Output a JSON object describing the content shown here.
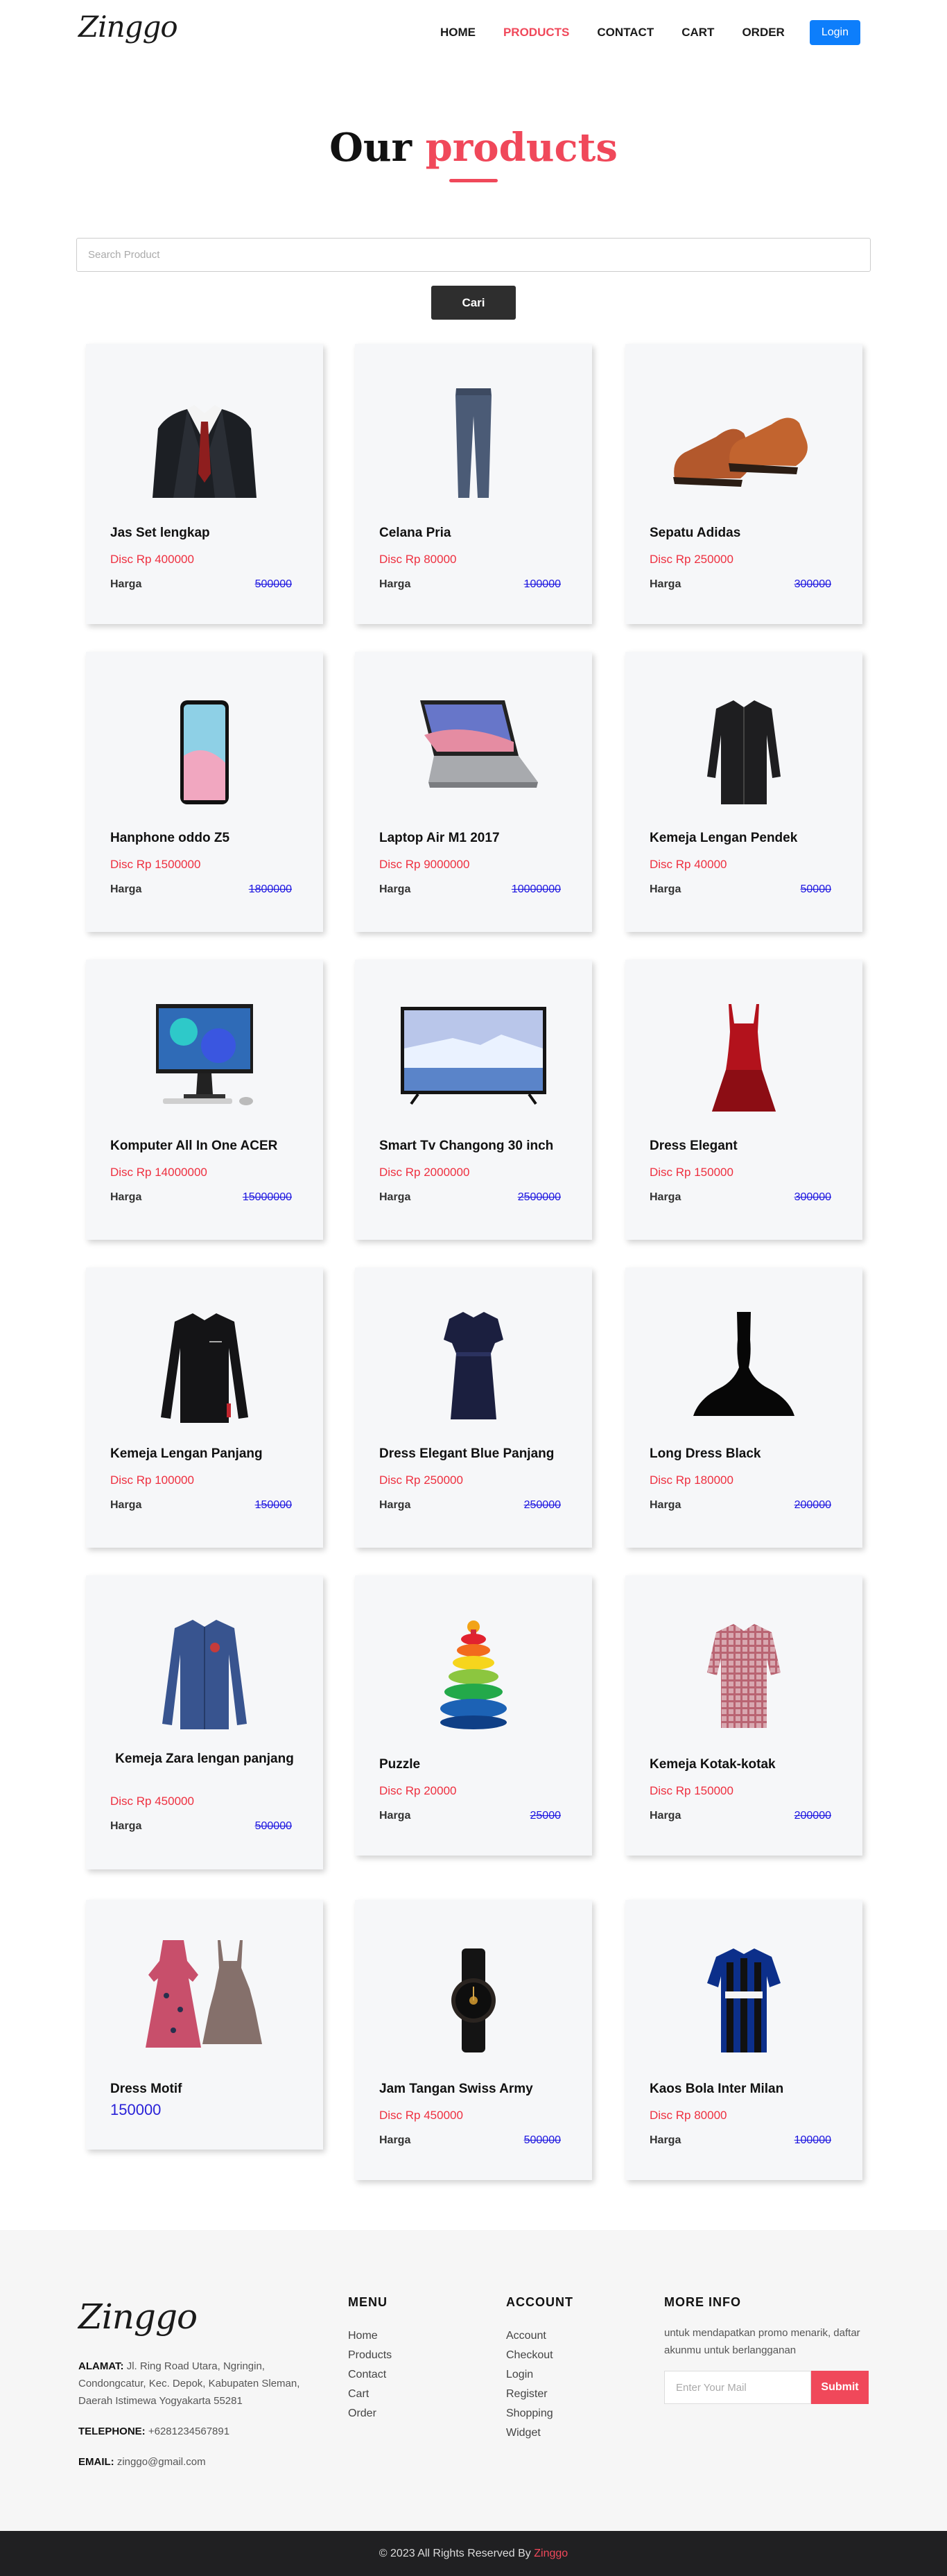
{
  "header": {
    "logo": "Zinggo",
    "nav": [
      "HOME",
      "PRODUCTS",
      "CONTACT",
      "CART",
      "ORDER"
    ],
    "active_nav": "PRODUCTS",
    "login_label": "Login"
  },
  "page": {
    "title_part1": "Our",
    "title_part2": "products"
  },
  "search": {
    "placeholder": "Search Product",
    "button_label": "Cari"
  },
  "products": [
    {
      "name": "Jas Set lengkap",
      "disc": "Disc Rp 400000",
      "harga_label": "Harga",
      "original": "500000",
      "icon": "suit-icon"
    },
    {
      "name": "Celana Pria",
      "disc": "Disc Rp 80000",
      "harga_label": "Harga",
      "original": "100000",
      "icon": "trousers-icon"
    },
    {
      "name": "Sepatu Adidas",
      "disc": "Disc Rp 250000",
      "harga_label": "Harga",
      "original": "300000",
      "icon": "shoes-icon"
    },
    {
      "name": "Hanphone oddo Z5",
      "disc": "Disc Rp 1500000",
      "harga_label": "Harga",
      "original": "1800000",
      "icon": "smartphone-icon"
    },
    {
      "name": "Laptop Air M1 2017",
      "disc": "Disc Rp 9000000",
      "harga_label": "Harga",
      "original": "10000000",
      "icon": "laptop-icon"
    },
    {
      "name": "Kemeja Lengan Pendek",
      "disc": "Disc Rp 40000",
      "harga_label": "Harga",
      "original": "50000",
      "icon": "black-shirt-icon"
    },
    {
      "name": "Komputer All In One ACER",
      "disc": "Disc Rp 14000000",
      "harga_label": "Harga",
      "original": "15000000",
      "icon": "desktop-computer-icon"
    },
    {
      "name": "Smart Tv Changong 30 inch",
      "disc": "Disc Rp 2000000",
      "harga_label": "Harga",
      "original": "2500000",
      "icon": "television-icon"
    },
    {
      "name": "Dress Elegant",
      "disc": "Disc Rp 150000",
      "harga_label": "Harga",
      "original": "300000",
      "icon": "red-dress-icon"
    },
    {
      "name": "Kemeja Lengan Panjang",
      "disc": "Disc Rp 100000",
      "harga_label": "Harga",
      "original": "150000",
      "icon": "long-sleeve-shirt-icon"
    },
    {
      "name": "Dress Elegant Blue Panjang",
      "disc": "Disc Rp 250000",
      "harga_label": "Harga",
      "original": "250000",
      "icon": "blue-dress-icon"
    },
    {
      "name": "Long Dress Black",
      "disc": "Disc Rp 180000",
      "harga_label": "Harga",
      "original": "200000",
      "icon": "black-gown-icon"
    },
    {
      "name": "Kemeja Zara lengan panjang",
      "disc": "Disc Rp 450000",
      "harga_label": "Harga",
      "original": "500000",
      "icon": "denim-shirt-icon"
    },
    {
      "name": "Puzzle",
      "disc": "Disc Rp 20000",
      "harga_label": "Harga",
      "original": "25000",
      "icon": "stacking-rings-toy-icon"
    },
    {
      "name": "Kemeja Kotak-kotak",
      "disc": "Disc Rp 150000",
      "harga_label": "Harga",
      "original": "200000",
      "icon": "plaid-shirt-icon"
    },
    {
      "name": "Dress Motif",
      "price": "150000",
      "icon": "floral-dresses-icon"
    },
    {
      "name": "Jam Tangan Swiss Army",
      "disc": "Disc Rp 450000",
      "harga_label": "Harga",
      "original": "500000",
      "icon": "wristwatch-icon"
    },
    {
      "name": "Kaos Bola Inter Milan",
      "disc": "Disc Rp 80000",
      "harga_label": "Harga",
      "original": "100000",
      "icon": "football-jersey-icon"
    }
  ],
  "footer": {
    "logo": "Zinggo",
    "address_label": "ALAMAT:",
    "address": "Jl. Ring Road Utara, Ngringin, Condongcatur, Kec. Depok, Kabupaten Sleman, Daerah Istimewa Yogyakarta 55281",
    "telephone_label": "TELEPHONE:",
    "telephone": "+6281234567891",
    "email_label": "EMAIL:",
    "email": "zinggo@gmail.com",
    "menu_title": "MENU",
    "menu": [
      "Home",
      "Products",
      "Contact",
      "Cart",
      "Order"
    ],
    "account_title": "ACCOUNT",
    "account": [
      "Account",
      "Checkout",
      "Login",
      "Register",
      "Shopping",
      "Widget"
    ],
    "more_title": "MORE INFO",
    "more_text": "untuk mendapatkan promo menarik, daftar akunmu untuk berlangganan",
    "mail_placeholder": "Enter Your Mail",
    "submit_label": "Submit",
    "copyright_prefix": "© 2023 All Rights Reserved By",
    "copyright_brand": "Zinggo"
  },
  "colors": {
    "accent": "#f0485a",
    "login_blue": "#0d7efb",
    "disc_red": "#ee2f3f",
    "strike_blue": "#1b14e0"
  }
}
